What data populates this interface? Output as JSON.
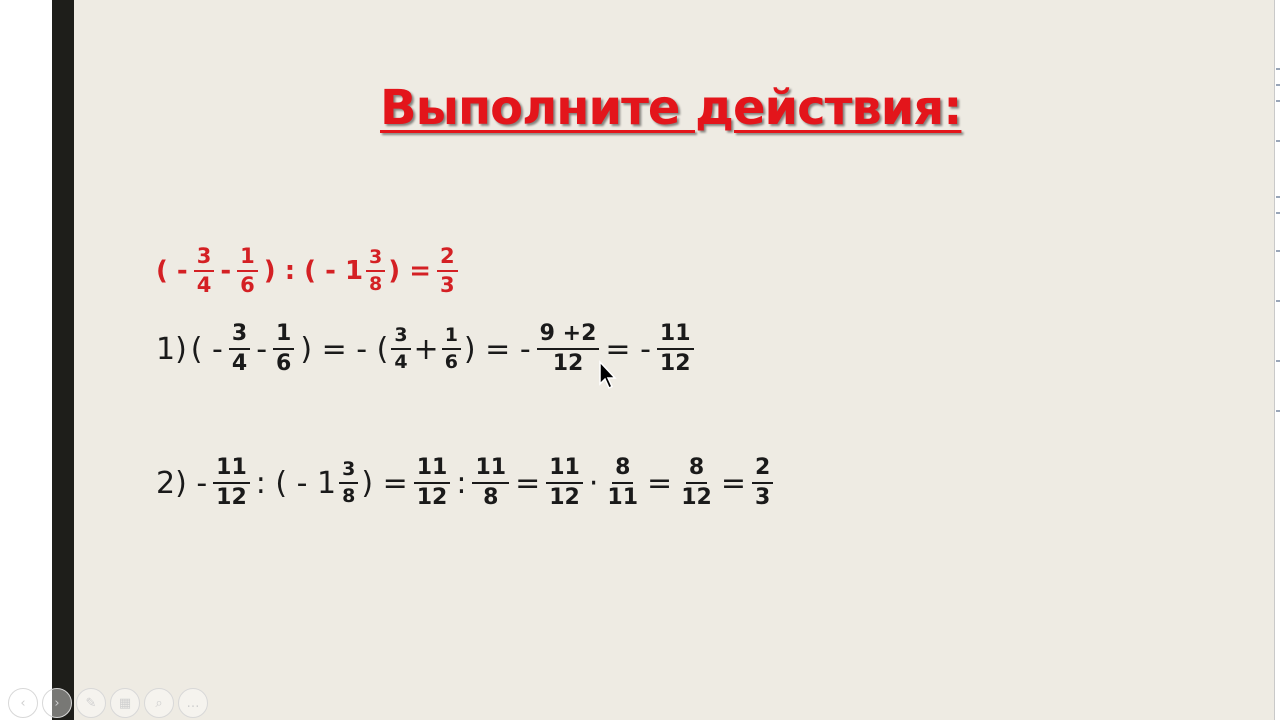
{
  "title": "Выполните действия:",
  "problem": {
    "open1": "( -",
    "f1": {
      "num": "3",
      "den": "4"
    },
    "minus1": "-",
    "f2": {
      "num": "1",
      "den": "6"
    },
    "close_div": ") : ( - 1",
    "f3": {
      "num": "3",
      "den": "8"
    },
    "close_eq": ") =",
    "result": {
      "num": "2",
      "den": "3"
    }
  },
  "step1": {
    "label": "1)",
    "open": "( -",
    "f1": {
      "num": "3",
      "den": "4"
    },
    "minus": "-",
    "f2": {
      "num": "1",
      "den": "6"
    },
    "eq_open": ") = - (",
    "f3": {
      "num": "3",
      "den": "4"
    },
    "plus": "+",
    "f4": {
      "num": "1",
      "den": "6"
    },
    "eq2": ") = -",
    "f5": {
      "num": "9 +2",
      "den": "12"
    },
    "eq3": "= -",
    "f6": {
      "num": "11",
      "den": "12"
    }
  },
  "step2": {
    "label": "2) -",
    "f1": {
      "num": "11",
      "den": "12"
    },
    "div_open": ": ( - 1",
    "f2": {
      "num": "3",
      "den": "8"
    },
    "close_eq": ")  =",
    "f3": {
      "num": "11",
      "den": "12"
    },
    "div": ":",
    "f4": {
      "num": "11",
      "den": "8"
    },
    "eq1": "=",
    "f5": {
      "num": "11",
      "den": "12"
    },
    "dot": "·",
    "f6": {
      "num": "8",
      "den": "11"
    },
    "eq2": "=",
    "f7": {
      "num": "8",
      "den": "12"
    },
    "eq3": "=",
    "f8": {
      "num": "2",
      "den": "3"
    }
  },
  "toolbar": {
    "icons": [
      "prev-icon",
      "next-icon",
      "pen-icon",
      "slides-icon",
      "zoom-icon",
      "more-icon"
    ],
    "glyphs": [
      "‹",
      "›",
      "✎",
      "▦",
      "⌕",
      "…"
    ]
  },
  "colors": {
    "title": "#e3151b",
    "problem": "#d42024",
    "text": "#1a1a1a",
    "slide_bg": "#eeebe3"
  }
}
